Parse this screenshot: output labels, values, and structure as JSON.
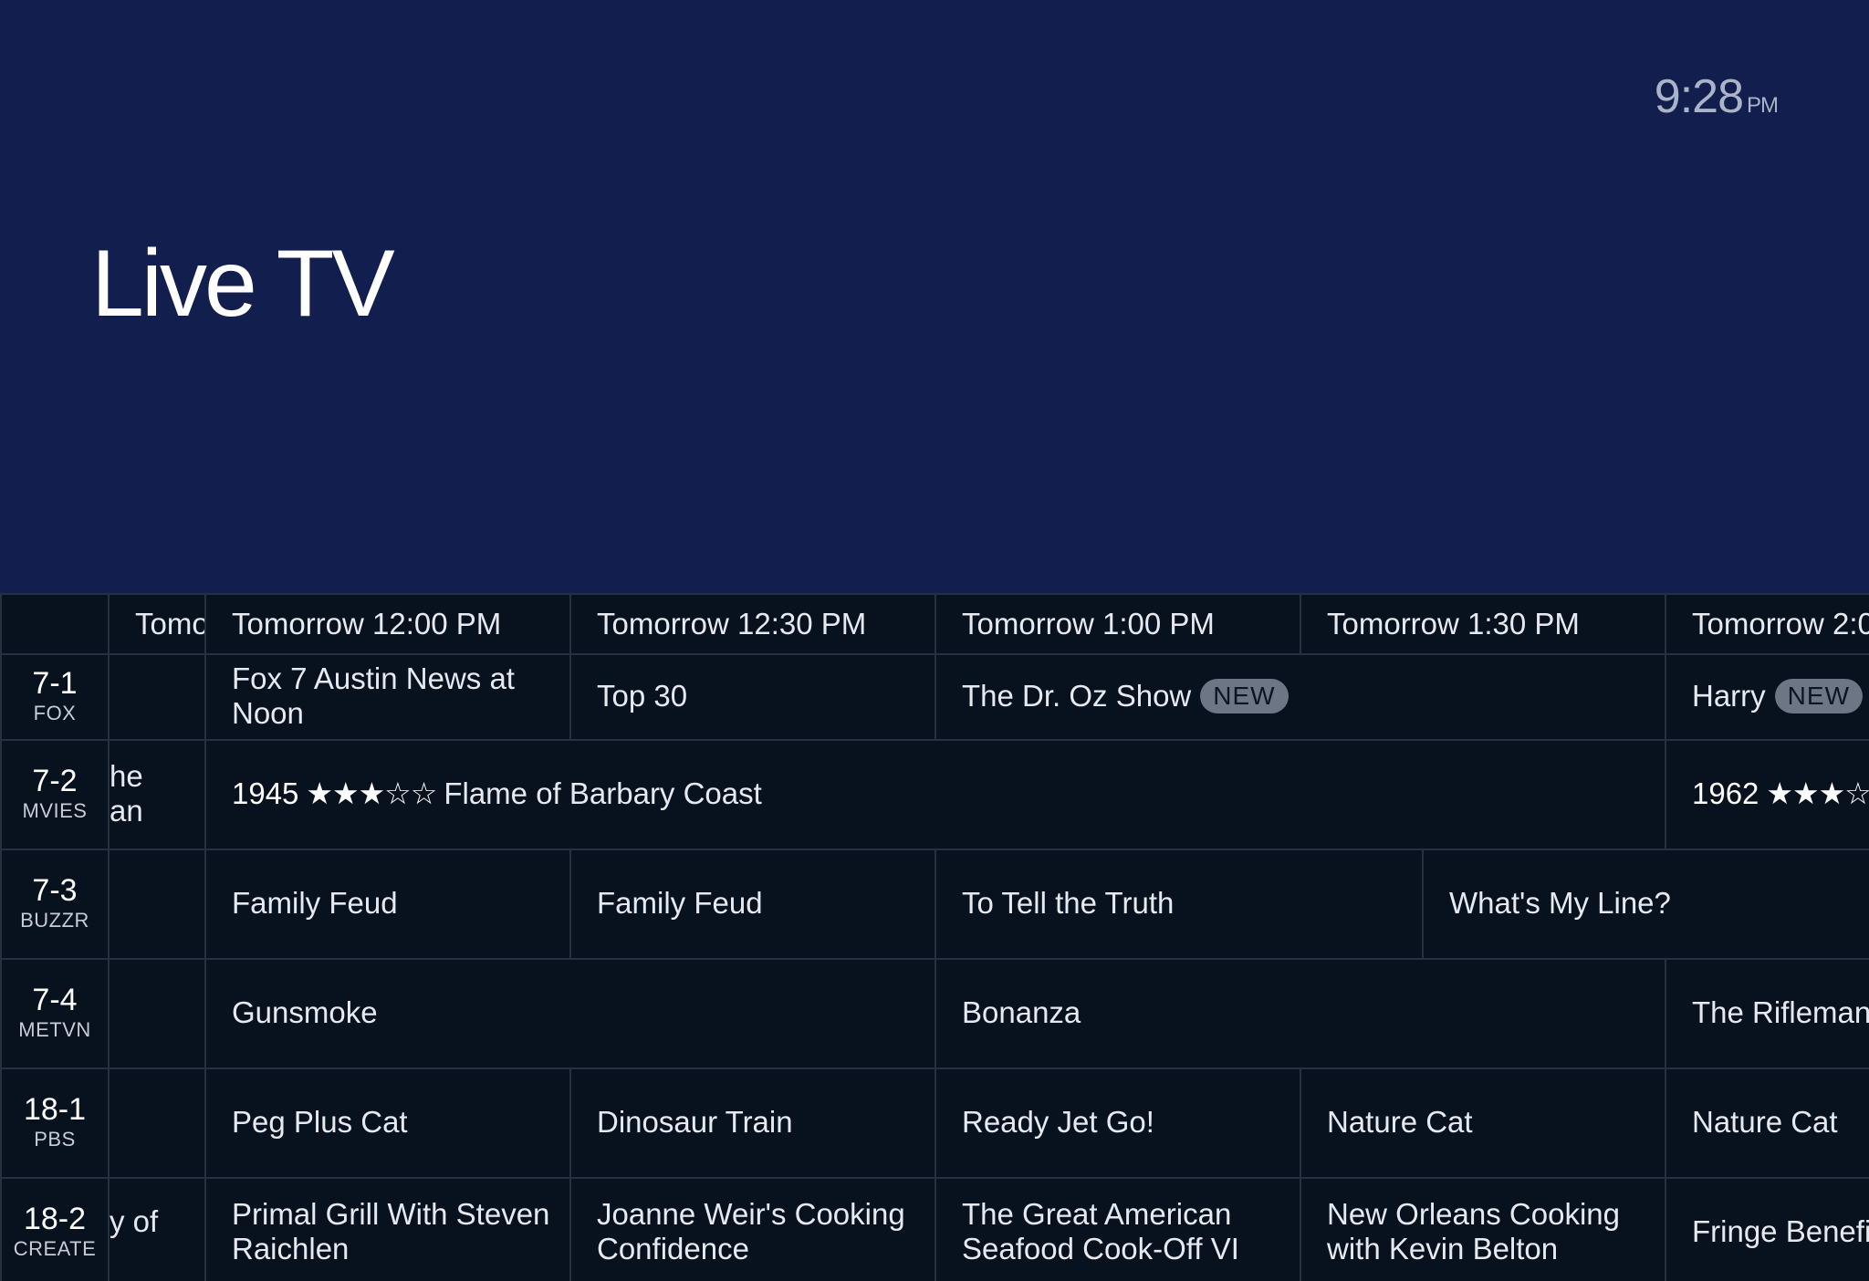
{
  "header": {
    "title": "Live TV",
    "clock_time": "9:28",
    "clock_ampm": "PM"
  },
  "timeline": [
    "Tomo",
    "Tomorrow 12:00 PM",
    "Tomorrow 12:30 PM",
    "Tomorrow 1:00 PM",
    "Tomorrow 1:30 PM",
    "Tomorrow 2:0"
  ],
  "channels": [
    {
      "number": "7-1",
      "call": "FOX"
    },
    {
      "number": "7-2",
      "call": "MVIES"
    },
    {
      "number": "7-3",
      "call": "BUZZR"
    },
    {
      "number": "7-4",
      "call": "METVN"
    },
    {
      "number": "18-1",
      "call": "PBS"
    },
    {
      "number": "18-2",
      "call": "CREATE"
    }
  ],
  "badge_label": "NEW",
  "programs": {
    "r1": [
      "Fox 7 Austin News at Noon",
      "Top 30",
      "The Dr. Oz Show",
      "Harry"
    ],
    "r2": {
      "stub": "he\nan",
      "movie1_year": "1945",
      "movie1_stars": "★★★☆☆",
      "movie1_title": "Flame of Barbary Coast",
      "movie2_year": "1962",
      "movie2_stars": "★★★☆"
    },
    "r3": [
      "Family Feud",
      "Family Feud",
      "To Tell the Truth",
      "What's My Line?"
    ],
    "r4": [
      "Gunsmoke",
      "Bonanza",
      "The Rifleman"
    ],
    "r5": [
      "Peg Plus Cat",
      "Dinosaur Train",
      "Ready Jet Go!",
      "Nature Cat",
      "Nature Cat"
    ],
    "r6": {
      "stub": "y of",
      "items": [
        "Primal Grill With Steven Raichlen",
        "Joanne Weir's Cooking Confidence",
        "The Great American Seafood Cook-Off VI",
        "New Orleans Cooking with Kevin Belton",
        "Fringe Benefi"
      ]
    }
  },
  "colors": {
    "hero_bg": "#121f4e",
    "guide_bg": "#08111e",
    "grid_line": "#253140",
    "badge_bg": "#6c7684"
  }
}
